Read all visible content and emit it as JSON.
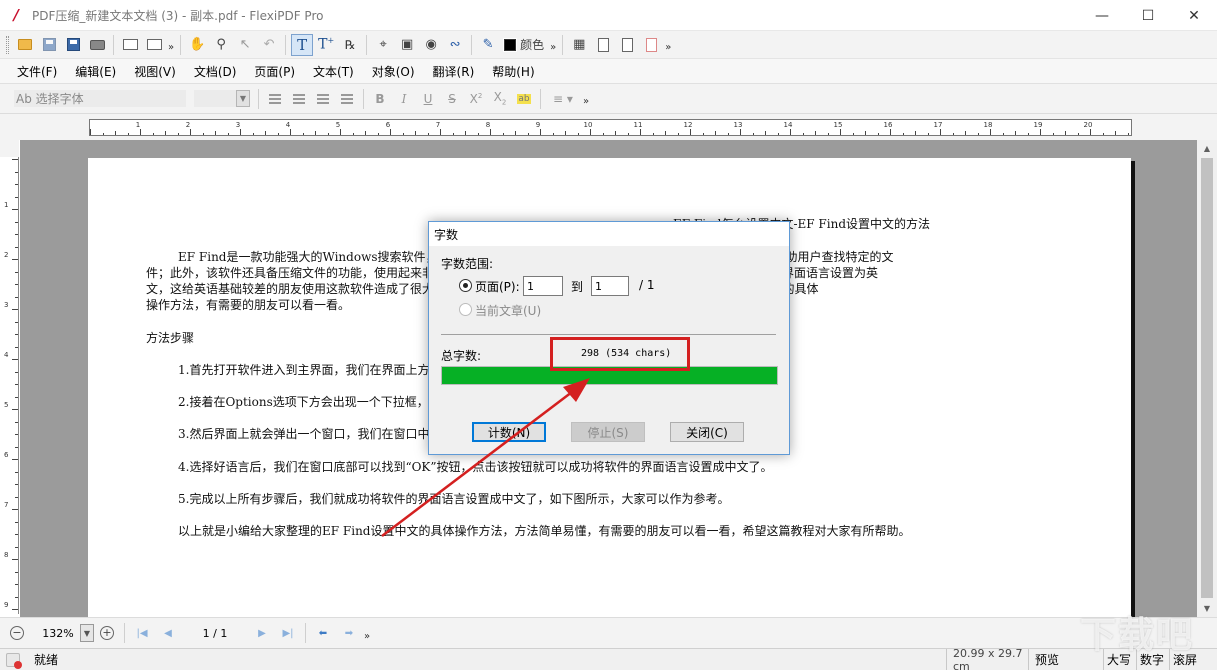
{
  "window": {
    "title": "PDF压缩_新建文本文档 (3) - 副本.pdf - FlexiPDF Pro"
  },
  "toolbar": {
    "color_label": "颜色"
  },
  "menu": {
    "items": [
      "文件(F)",
      "编辑(E)",
      "视图(V)",
      "文档(D)",
      "页面(P)",
      "文本(T)",
      "对象(O)",
      "翻译(R)",
      "帮助(H)"
    ]
  },
  "format_bar": {
    "font_placeholder": "Ab 选择字体"
  },
  "ruler": {
    "h_numbers": [
      "1",
      "2",
      "3",
      "4",
      "5",
      "6",
      "7",
      "8",
      "9",
      "10",
      "11",
      "12",
      "13",
      "14",
      "15",
      "16",
      "17",
      "18",
      "19",
      "20"
    ],
    "v_numbers": [
      "1",
      "2",
      "3",
      "4",
      "5",
      "6",
      "7",
      "8",
      "9"
    ]
  },
  "document": {
    "lines": [
      "EF Find怎么设置中文-EF Find设置中文的方法",
      "EF Find是一款功能强大的Windows搜索软件，只需要用户设置好搜索的关键词和搜索的磁盘，软件就可以自动帮助用户查找特定的文",
      "件；此外，该软件还具备压缩文件的功能，使用起来非常的方便。我们在使用这款软件的过程中，有时候可能会不小心将界面语言设置为英",
      "文，这给英语基础较差的朋友使用这款软件造成了很大的不便。那么接下来小编就给大家详细介绍一下EF Find设置中文的具体",
      "操作方法，有需要的朋友可以看一看。",
      "方法步骤",
      "1.首先打开软件进入到主界面，我们在界面上方找到“Options”选项，点击该选项即可。",
      "2.接着在Options选项下方会出现一个下拉框，我们在下拉框中选择“Language”选项。",
      "3.然后界面上就会弹出一个窗口，我们在窗口中找到需要设置的语言，并点击选中该选项。",
      "4.选择好语言后，我们在窗口底部可以找到“OK”按钮，点击该按钮就可以成功将软件的界面语言设置成中文了。",
      "5.完成以上所有步骤后，我们就成功将软件的界面语言设置成中文了，如下图所示，大家可以作为参考。",
      "以上就是小编给大家整理的EF Find设置中文的具体操作方法，方法简单易懂，有需要的朋友可以看一看，希望这篇教程对大家有所帮助。"
    ]
  },
  "navbar": {
    "zoom": "132%",
    "page_indicator": "1 / 1"
  },
  "statusbar": {
    "status": "就绪",
    "page_size": "20.99 x 29.7 cm",
    "preview": "预览",
    "caps": "大写",
    "num": "数字",
    "scroll": "滚屏"
  },
  "dialog": {
    "title": "字数",
    "range_label": "字数范围:",
    "page_option": "页面(P):",
    "from_value": "1",
    "to_label": "到",
    "to_value": "1",
    "of_label": "/  1",
    "article_option": "当前文章(U)",
    "total_label": "总字数:",
    "total_value": "298 (534 chars)",
    "progress": 1.0,
    "count_button": "计数(N)",
    "stop_button": "停止(S)",
    "close_button": "关闭(C)"
  },
  "watermark": "下载吧",
  "colors": {
    "progress_green": "#06b025",
    "highlight_red": "#d42020",
    "canvas_gray": "#9b9b9b"
  }
}
